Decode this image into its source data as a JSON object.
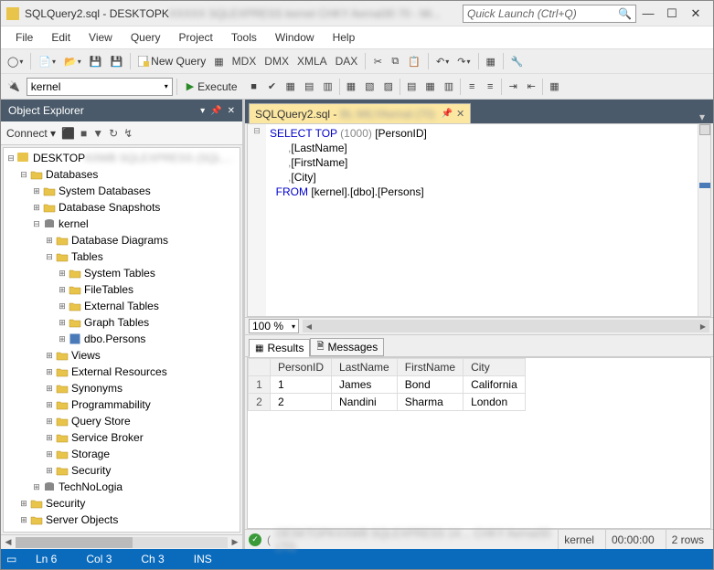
{
  "window": {
    "title_prefix": "SQLQuery2.sql - DESKTOPK",
    "quick_launch_placeholder": "Quick Launch (Ctrl+Q)"
  },
  "menu": [
    "File",
    "Edit",
    "View",
    "Query",
    "Project",
    "Tools",
    "Window",
    "Help"
  ],
  "toolbar": {
    "new_query": "New Query"
  },
  "toolbar2": {
    "db": "kernel",
    "execute": "Execute"
  },
  "object_explorer": {
    "title": "Object Explorer",
    "connect": "Connect",
    "root": "DESKTOP",
    "nodes": {
      "databases": "Databases",
      "system_databases": "System Databases",
      "database_snapshots": "Database Snapshots",
      "kernel": "kernel",
      "database_diagrams": "Database Diagrams",
      "tables": "Tables",
      "system_tables": "System Tables",
      "filetables": "FileTables",
      "external_tables": "External Tables",
      "graph_tables": "Graph Tables",
      "dbo_persons": "dbo.Persons",
      "views": "Views",
      "external_resources": "External Resources",
      "synonyms": "Synonyms",
      "programmability": "Programmability",
      "query_store": "Query Store",
      "service_broker": "Service Broker",
      "storage": "Storage",
      "security_db": "Security",
      "technologia": "TechNoLogia",
      "security": "Security",
      "server_objects": "Server Objects"
    }
  },
  "editor": {
    "tab_label": "SQLQuery2.sql - ",
    "code": {
      "l1_a": "SELECT",
      "l1_b": "TOP",
      "l1_c": "(1000)",
      "l1_d": " [PersonID]",
      "l2": ",[LastName]",
      "l3": ",[FirstName]",
      "l4": ",[City]",
      "l5_a": "FROM",
      "l5_b": " [kernel].[dbo].[Persons]"
    },
    "zoom": "100 %"
  },
  "results": {
    "tab_results": "Results",
    "tab_messages": "Messages",
    "columns": [
      "PersonID",
      "LastName",
      "FirstName",
      "City"
    ],
    "rows": [
      {
        "n": "1",
        "PersonID": "1",
        "LastName": "James",
        "FirstName": "Bond",
        "City": "California"
      },
      {
        "n": "2",
        "PersonID": "2",
        "LastName": "Nandini",
        "FirstName": "Sharma",
        "City": "London"
      }
    ],
    "status": {
      "db": "kernel",
      "time": "00:00:00",
      "rows": "2 rows"
    }
  },
  "statusbar": {
    "ln": "Ln 6",
    "col": "Col 3",
    "ch": "Ch 3",
    "ins": "INS"
  }
}
